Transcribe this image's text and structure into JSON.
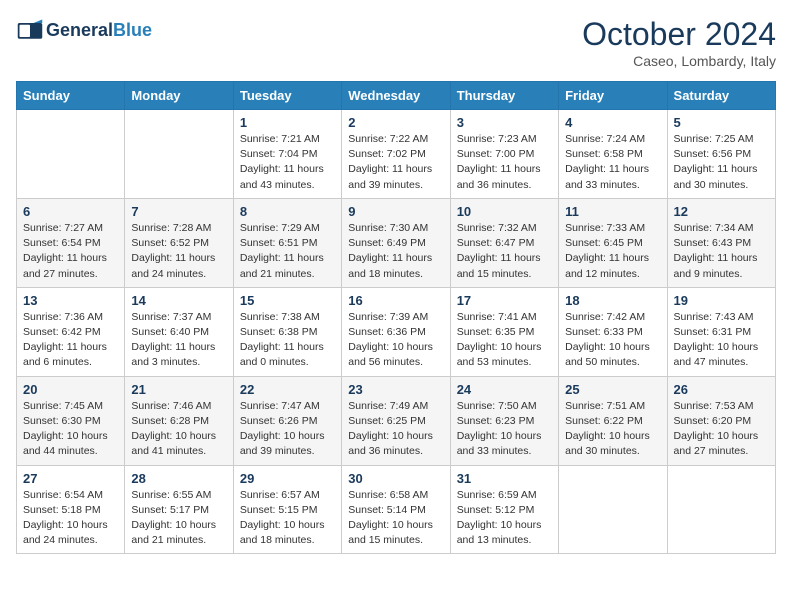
{
  "logo": {
    "general": "General",
    "blue": "Blue"
  },
  "header": {
    "month": "October 2024",
    "location": "Caseo, Lombardy, Italy"
  },
  "weekdays": [
    "Sunday",
    "Monday",
    "Tuesday",
    "Wednesday",
    "Thursday",
    "Friday",
    "Saturday"
  ],
  "weeks": [
    [
      {
        "day": "",
        "info": ""
      },
      {
        "day": "",
        "info": ""
      },
      {
        "day": "1",
        "info": "Sunrise: 7:21 AM\nSunset: 7:04 PM\nDaylight: 11 hours and 43 minutes."
      },
      {
        "day": "2",
        "info": "Sunrise: 7:22 AM\nSunset: 7:02 PM\nDaylight: 11 hours and 39 minutes."
      },
      {
        "day": "3",
        "info": "Sunrise: 7:23 AM\nSunset: 7:00 PM\nDaylight: 11 hours and 36 minutes."
      },
      {
        "day": "4",
        "info": "Sunrise: 7:24 AM\nSunset: 6:58 PM\nDaylight: 11 hours and 33 minutes."
      },
      {
        "day": "5",
        "info": "Sunrise: 7:25 AM\nSunset: 6:56 PM\nDaylight: 11 hours and 30 minutes."
      }
    ],
    [
      {
        "day": "6",
        "info": "Sunrise: 7:27 AM\nSunset: 6:54 PM\nDaylight: 11 hours and 27 minutes."
      },
      {
        "day": "7",
        "info": "Sunrise: 7:28 AM\nSunset: 6:52 PM\nDaylight: 11 hours and 24 minutes."
      },
      {
        "day": "8",
        "info": "Sunrise: 7:29 AM\nSunset: 6:51 PM\nDaylight: 11 hours and 21 minutes."
      },
      {
        "day": "9",
        "info": "Sunrise: 7:30 AM\nSunset: 6:49 PM\nDaylight: 11 hours and 18 minutes."
      },
      {
        "day": "10",
        "info": "Sunrise: 7:32 AM\nSunset: 6:47 PM\nDaylight: 11 hours and 15 minutes."
      },
      {
        "day": "11",
        "info": "Sunrise: 7:33 AM\nSunset: 6:45 PM\nDaylight: 11 hours and 12 minutes."
      },
      {
        "day": "12",
        "info": "Sunrise: 7:34 AM\nSunset: 6:43 PM\nDaylight: 11 hours and 9 minutes."
      }
    ],
    [
      {
        "day": "13",
        "info": "Sunrise: 7:36 AM\nSunset: 6:42 PM\nDaylight: 11 hours and 6 minutes."
      },
      {
        "day": "14",
        "info": "Sunrise: 7:37 AM\nSunset: 6:40 PM\nDaylight: 11 hours and 3 minutes."
      },
      {
        "day": "15",
        "info": "Sunrise: 7:38 AM\nSunset: 6:38 PM\nDaylight: 11 hours and 0 minutes."
      },
      {
        "day": "16",
        "info": "Sunrise: 7:39 AM\nSunset: 6:36 PM\nDaylight: 10 hours and 56 minutes."
      },
      {
        "day": "17",
        "info": "Sunrise: 7:41 AM\nSunset: 6:35 PM\nDaylight: 10 hours and 53 minutes."
      },
      {
        "day": "18",
        "info": "Sunrise: 7:42 AM\nSunset: 6:33 PM\nDaylight: 10 hours and 50 minutes."
      },
      {
        "day": "19",
        "info": "Sunrise: 7:43 AM\nSunset: 6:31 PM\nDaylight: 10 hours and 47 minutes."
      }
    ],
    [
      {
        "day": "20",
        "info": "Sunrise: 7:45 AM\nSunset: 6:30 PM\nDaylight: 10 hours and 44 minutes."
      },
      {
        "day": "21",
        "info": "Sunrise: 7:46 AM\nSunset: 6:28 PM\nDaylight: 10 hours and 41 minutes."
      },
      {
        "day": "22",
        "info": "Sunrise: 7:47 AM\nSunset: 6:26 PM\nDaylight: 10 hours and 39 minutes."
      },
      {
        "day": "23",
        "info": "Sunrise: 7:49 AM\nSunset: 6:25 PM\nDaylight: 10 hours and 36 minutes."
      },
      {
        "day": "24",
        "info": "Sunrise: 7:50 AM\nSunset: 6:23 PM\nDaylight: 10 hours and 33 minutes."
      },
      {
        "day": "25",
        "info": "Sunrise: 7:51 AM\nSunset: 6:22 PM\nDaylight: 10 hours and 30 minutes."
      },
      {
        "day": "26",
        "info": "Sunrise: 7:53 AM\nSunset: 6:20 PM\nDaylight: 10 hours and 27 minutes."
      }
    ],
    [
      {
        "day": "27",
        "info": "Sunrise: 6:54 AM\nSunset: 5:18 PM\nDaylight: 10 hours and 24 minutes."
      },
      {
        "day": "28",
        "info": "Sunrise: 6:55 AM\nSunset: 5:17 PM\nDaylight: 10 hours and 21 minutes."
      },
      {
        "day": "29",
        "info": "Sunrise: 6:57 AM\nSunset: 5:15 PM\nDaylight: 10 hours and 18 minutes."
      },
      {
        "day": "30",
        "info": "Sunrise: 6:58 AM\nSunset: 5:14 PM\nDaylight: 10 hours and 15 minutes."
      },
      {
        "day": "31",
        "info": "Sunrise: 6:59 AM\nSunset: 5:12 PM\nDaylight: 10 hours and 13 minutes."
      },
      {
        "day": "",
        "info": ""
      },
      {
        "day": "",
        "info": ""
      }
    ]
  ]
}
